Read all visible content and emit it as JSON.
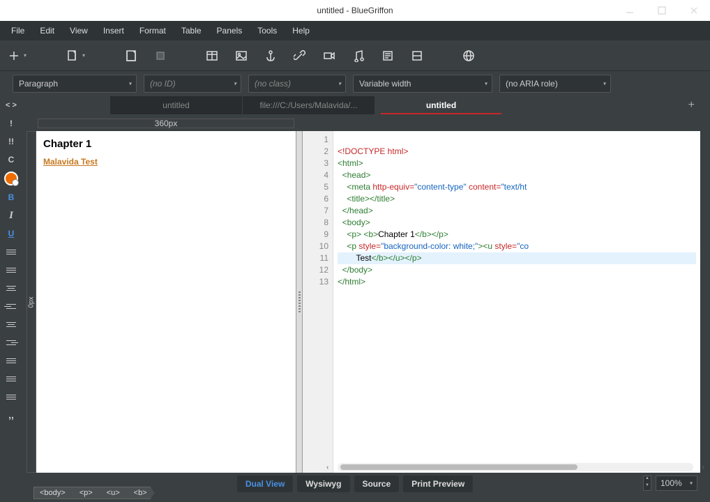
{
  "window": {
    "title": "untitled - BlueGriffon"
  },
  "menu": [
    "File",
    "Edit",
    "View",
    "Insert",
    "Format",
    "Table",
    "Panels",
    "Tools",
    "Help"
  ],
  "dropdowns": {
    "para": "Paragraph",
    "id": "(no ID)",
    "cls": "(no class)",
    "font": "Variable width",
    "aria": "(no ARIA role)"
  },
  "tabs": [
    {
      "label": "untitled",
      "active": false
    },
    {
      "label": "file:///C:/Users/Malavida/...",
      "active": false
    },
    {
      "label": "untitled",
      "active": true
    }
  ],
  "ruler": "360px",
  "vruler": "0px",
  "preview": {
    "heading": "Chapter 1",
    "text1": "Malavida ",
    "text2": "Test"
  },
  "code_lines": [
    "1",
    "2",
    "3",
    "4",
    "5",
    "6",
    "7",
    "8",
    "9",
    "10",
    "11",
    "12",
    "13"
  ],
  "code": {
    "l1a": "<!DOCTYPE html>",
    "l2": "<html>",
    "l3": "<head>",
    "l4a": "<meta",
    "l4b": "http-equiv=",
    "l4c": "\"content-type\"",
    "l4d": "content=",
    "l4e": "\"text/ht",
    "l5a": "<title>",
    "l5b": "</title>",
    "l6": "</head>",
    "l7": "<body>",
    "l8a": "<p>",
    "l8b": "<b>",
    "l8c": "Chapter 1",
    "l8d": "</b>",
    "l8e": "</p>",
    "l9a": "<p",
    "l9b": "style=",
    "l9c": "\"background-color: white;\"",
    "l9d": "><u",
    "l9e": "style=",
    "l9f": "\"co",
    "l10a": "Test",
    "l10b": "</b>",
    "l10c": "</u>",
    "l10d": "</p>",
    "l11": "</body>",
    "l12": "</html>"
  },
  "views": {
    "dual": "Dual View",
    "wys": "Wysiwyg",
    "src": "Source",
    "prev": "Print Preview"
  },
  "zoom": "100%",
  "breadcrumb": [
    "<body>",
    "<p>",
    "<u>",
    "<b>"
  ]
}
